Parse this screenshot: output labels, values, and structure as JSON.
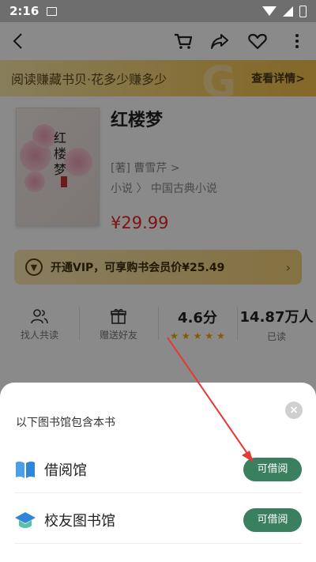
{
  "status_bar": {
    "time": "2:16"
  },
  "promo_banner": {
    "text": "阅读赚藏书贝·花多少赚多少",
    "link": "查看详情>",
    "deco": "G"
  },
  "book": {
    "title": "红楼梦",
    "cover_title": "红楼梦",
    "author": "[著] 曹雪芹 >",
    "category": "小说 〉 中国古典小说",
    "price": "¥29.99"
  },
  "vip_bar": {
    "text": "开通VIP，可享购书会员价¥25.49",
    "chevron": "›"
  },
  "stats": {
    "read_together_label": "找人共读",
    "gift_label": "赠送好友",
    "rating_value": "4.6分",
    "rating_stars": 4.6,
    "readers_value": "14.87万人",
    "readers_label": "已读"
  },
  "sheet": {
    "title": "以下图书馆包含本书",
    "close": "×",
    "libraries": [
      {
        "name": "借阅馆",
        "button": "可借阅",
        "icon": "open-book-icon"
      },
      {
        "name": "校友图书馆",
        "button": "可借阅",
        "icon": "graduation-cap-icon"
      }
    ]
  },
  "colors": {
    "accent_green": "#3a7f5e",
    "price_red": "#e22",
    "annotation_red": "#e53935"
  }
}
